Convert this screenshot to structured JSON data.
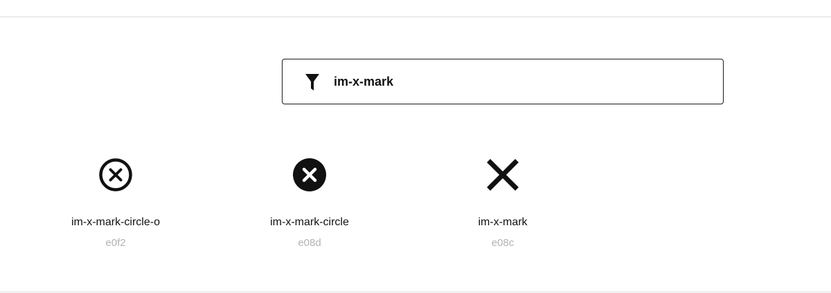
{
  "search": {
    "value": "im-x-mark",
    "filter_icon": "filter-icon"
  },
  "results": [
    {
      "name": "im-x-mark-circle-o",
      "code": "e0f2",
      "icon": "x-mark-circle-outline-icon"
    },
    {
      "name": "im-x-mark-circle",
      "code": "e08d",
      "icon": "x-mark-circle-filled-icon"
    },
    {
      "name": "im-x-mark",
      "code": "e08c",
      "icon": "x-mark-icon"
    }
  ],
  "colors": {
    "text": "#111111",
    "code_text": "#b3b3b3",
    "border": "#1a1a1a",
    "divider": "#dcdcdc"
  }
}
